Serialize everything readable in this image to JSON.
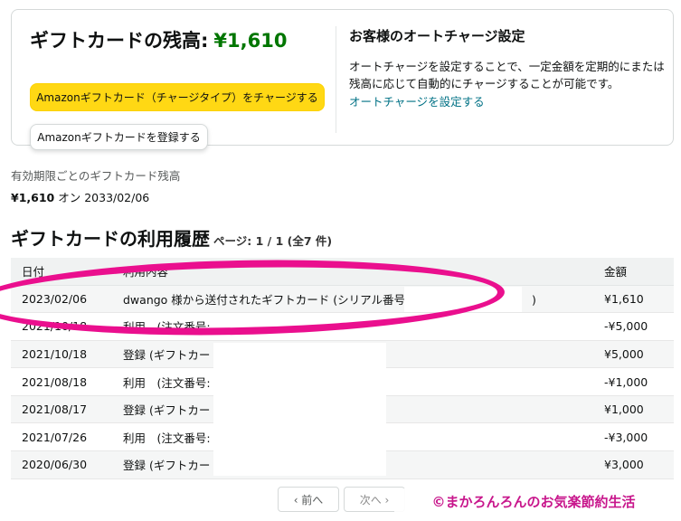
{
  "balance": {
    "title": "ギフトカードの残高:",
    "amount": "¥1,610",
    "charge_button": "Amazonギフトカード（チャージタイプ）をチャージする",
    "register_button": "Amazonギフトカードを登録する"
  },
  "auto_charge": {
    "title": "お客様のオートチャージ設定",
    "description": "オートチャージを設定することで、一定金額を定期的にまたは残高に応じて自動的にチャージすることが可能です。",
    "link": "オートチャージを設定する"
  },
  "expiry": {
    "label": "有効期限ごとのギフトカード残高",
    "amount": "¥1,610",
    "suffix": "オン 2033/02/06"
  },
  "history": {
    "title": "ギフトカードの利用履歴",
    "page_info": "ページ: 1 / 1 (全7 件)",
    "columns": [
      "日付",
      "利用内容",
      "金額"
    ],
    "rows": [
      {
        "date": "2023/02/06",
        "desc": "dwango 様から送付されたギフトカード (シリアル番号",
        "close": ")",
        "amount": "¥1,610"
      },
      {
        "date": "2021/10/18",
        "desc": "利用　(注文番号:",
        "close": "",
        "amount": "-¥5,000"
      },
      {
        "date": "2021/10/18",
        "desc": "登録 (ギフトカー",
        "close": "",
        "amount": "¥5,000"
      },
      {
        "date": "2021/08/18",
        "desc": "利用　(注文番号:",
        "close": "",
        "amount": "-¥1,000"
      },
      {
        "date": "2021/08/17",
        "desc": "登録 (ギフトカー",
        "close": "",
        "amount": "¥1,000"
      },
      {
        "date": "2021/07/26",
        "desc": "利用　(注文番号:",
        "close": "",
        "amount": "-¥3,000"
      },
      {
        "date": "2020/06/30",
        "desc": "登録 (ギフトカー",
        "close": "",
        "amount": "¥3,000"
      }
    ]
  },
  "pagination": {
    "prev": "‹ 前へ",
    "next": "次へ ›"
  },
  "watermark": "©まかろんろんのお気楽節約生活",
  "colors": {
    "balance_amount": "#007600",
    "charge_button": "#ffd814",
    "link": "#007185",
    "highlight": "#ea0f8e",
    "watermark": "#c8178c"
  }
}
